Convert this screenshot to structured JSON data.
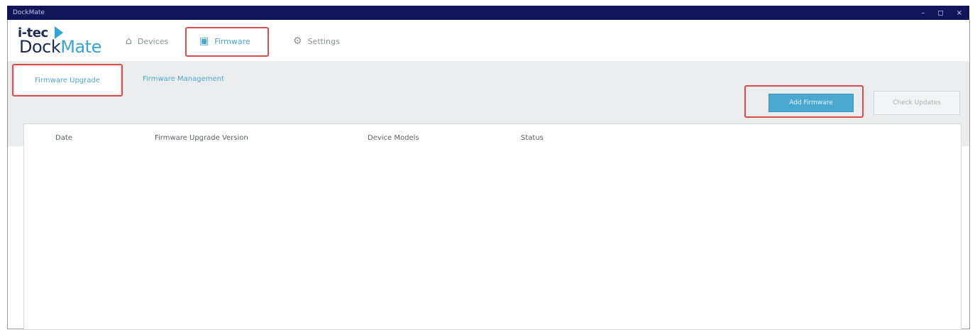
{
  "window": {
    "title": "DockMate",
    "controls": [
      "–",
      "◻",
      "×"
    ]
  },
  "logo": {
    "itec": "i-tec",
    "dock": "Dock",
    "mate": "Mate"
  },
  "nav": {
    "devices": {
      "label": "Devices",
      "icon": "home-icon"
    },
    "firmware": {
      "label": "Firmware",
      "icon": "firmware-icon"
    },
    "settings": {
      "label": "Settings",
      "icon": "gear-icon"
    }
  },
  "subtabs": {
    "upgrade": "Firmware Upgrade",
    "management": "Firmware Management"
  },
  "actions": {
    "primary": "Add Firmware",
    "secondary": "Check Updates"
  },
  "table": {
    "columns": [
      "Date",
      "Firmware Upgrade Version",
      "Device Models",
      "Status"
    ],
    "rows": []
  }
}
